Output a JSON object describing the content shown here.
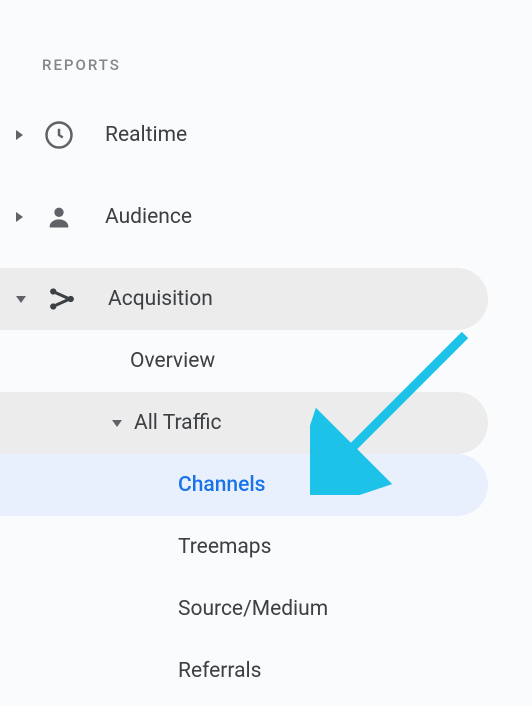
{
  "section": {
    "header": "REPORTS"
  },
  "nav": {
    "realtime": "Realtime",
    "audience": "Audience",
    "acquisition": "Acquisition"
  },
  "acquisition": {
    "overview": "Overview",
    "allTraffic": "All Traffic",
    "channels": "Channels",
    "treemaps": "Treemaps",
    "sourceMedium": "Source/Medium",
    "referrals": "Referrals"
  },
  "annotation": {
    "arrowColor": "#1dc2e8"
  }
}
